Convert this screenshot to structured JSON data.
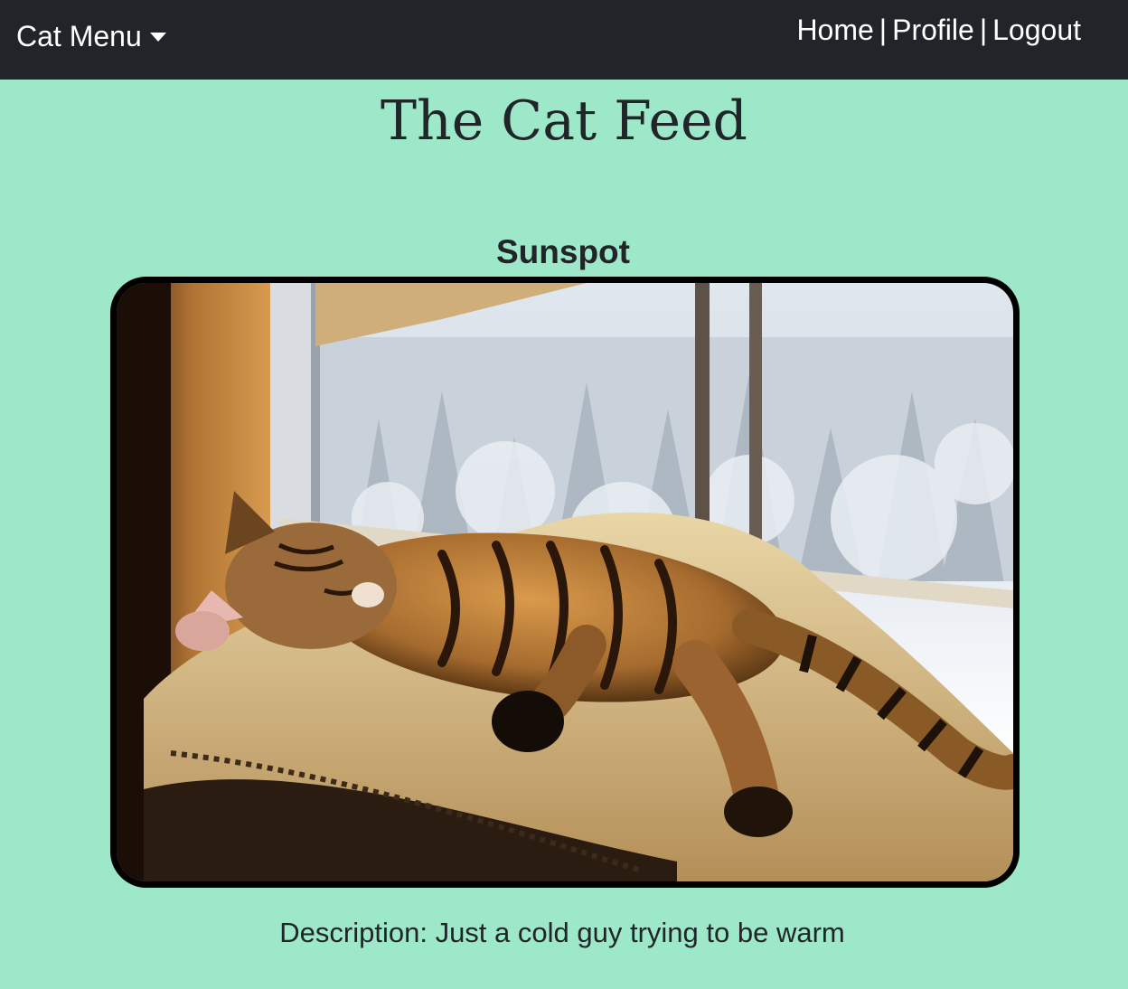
{
  "navbar": {
    "menu_label": "Cat Menu",
    "links": {
      "home": "Home",
      "profile": "Profile",
      "logout": "Logout"
    },
    "separator": "|"
  },
  "page": {
    "title": "The Cat Feed"
  },
  "post": {
    "title": "Sunspot",
    "description": "Description: Just a cold guy trying to be warm"
  },
  "colors": {
    "navbar_bg": "#212529",
    "page_bg": "#9de8c8",
    "text": "#212529",
    "photo_border": "#000000"
  }
}
